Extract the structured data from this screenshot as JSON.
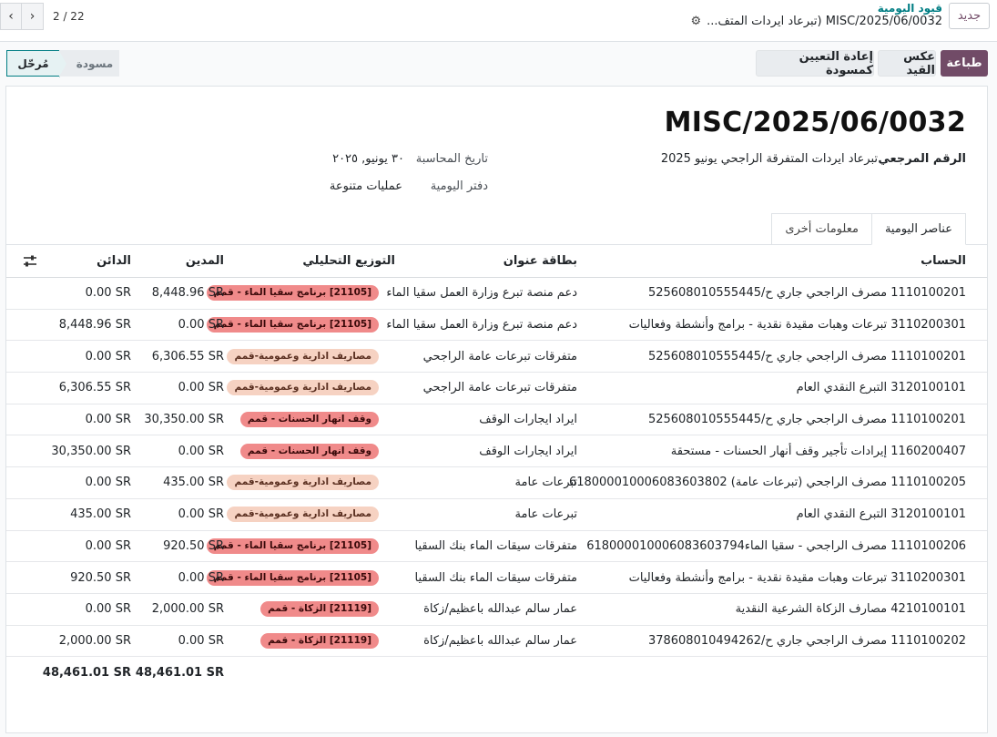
{
  "topbar": {
    "new_label": "جديد",
    "breadcrumb_parent": "قيود اليومية",
    "breadcrumb_current": "MISC/2025/06/0032 (تبرعاد ايردات المتف...",
    "pager_value": "2 / 22"
  },
  "actions": {
    "print": "طباعة",
    "reverse": "عكس القيد",
    "reset": "إعادة التعيين كمسودة"
  },
  "status": {
    "posted": "مُرحّل",
    "draft": "مسودة"
  },
  "form": {
    "title": "MISC/2025/06/0032",
    "ref_label": "الرقم المرجعي",
    "ref_value": "تبرعاد ايردات المتفرقة الراجحي يونيو 2025",
    "date_label": "تاريخ المحاسبة",
    "date_value": "٣٠ يونيو, ٢٠٢٥",
    "journal_label": "دفتر اليومية",
    "journal_value": "عمليات متنوعة"
  },
  "tabs": {
    "items": "عناصر اليومية",
    "other": "معلومات أخرى"
  },
  "table": {
    "headers": {
      "account": "الحساب",
      "label": "بطاقة عنوان",
      "analytic": "التوزيع التحليلي",
      "debit": "المدين",
      "credit": "الدائن"
    },
    "rows": [
      {
        "account": "1110100201 مصرف الراجحي جاري ح/525608010555445",
        "label": "دعم منصة تبرع وزارة العمل سقيا الماء",
        "tag": "[21105] برنامج سقيا الماء - قمم",
        "debit": "8,448.96 SR",
        "credit": "0.00 SR"
      },
      {
        "account": "3110200301 تبرعات وهبات مقيدة نقدية - برامج وأنشطة وفعاليات",
        "label": "دعم منصة تبرع وزارة العمل سقيا الماء",
        "tag": "[21105] برنامج سقيا الماء - قمم",
        "debit": "0.00 SR",
        "credit": "8,448.96 SR"
      },
      {
        "account": "1110100201 مصرف الراجحي جاري ح/525608010555445",
        "label": "متفرقات تبرعات عامة الراجحي",
        "tag": "مصاريف ادارية وعمومية-قمم",
        "debit": "6,306.55 SR",
        "credit": "0.00 SR"
      },
      {
        "account": "3120100101 التبرع النقدي العام",
        "label": "متفرقات تبرعات عامة الراجحي",
        "tag": "مصاريف ادارية وعمومية-قمم",
        "debit": "0.00 SR",
        "credit": "6,306.55 SR"
      },
      {
        "account": "1110100201 مصرف الراجحي جاري ح/525608010555445",
        "label": "ايراد ايجارات الوقف",
        "tag": "وقف انهار الحسنات - قمم",
        "debit": "30,350.00 SR",
        "credit": "0.00 SR"
      },
      {
        "account": "1160200407 إيرادات تأجير وقف أنهار الحسنات - مستحقة",
        "label": "ايراد ايجارات الوقف",
        "tag": "وقف انهار الحسنات - قمم",
        "debit": "0.00 SR",
        "credit": "30,350.00 SR"
      },
      {
        "account": "1110100205 مصرف الراجحي (تبرعات عامة) 618000010006083603802",
        "label": "تبرعات عامة",
        "tag": "مصاريف ادارية وعمومية-قمم",
        "debit": "435.00 SR",
        "credit": "0.00 SR"
      },
      {
        "account": "3120100101 التبرع النقدي العام",
        "label": "تبرعات عامة",
        "tag": "مصاريف ادارية وعمومية-قمم",
        "debit": "0.00 SR",
        "credit": "435.00 SR"
      },
      {
        "account": "1110100206 مصرف الراجحي - سقيا الماء618000010006083603794",
        "label": "متفرقات سيقات الماء بنك السقيا",
        "tag": "[21105] برنامج سقيا الماء - قمم",
        "debit": "920.50 SR",
        "credit": "0.00 SR"
      },
      {
        "account": "3110200301 تبرعات وهبات مقيدة نقدية - برامج وأنشطة وفعاليات",
        "label": "متفرقات سيقات الماء بنك السقيا",
        "tag": "[21105] برنامج سقيا الماء - قمم",
        "debit": "0.00 SR",
        "credit": "920.50 SR"
      },
      {
        "account": "4210100101 مصارف الزكاة الشرعية النقدية",
        "label": "عمار سالم عبدالله باعظيم/زكاة",
        "tag": "[21119] الزكاة - قمم",
        "debit": "2,000.00 SR",
        "credit": "0.00 SR"
      },
      {
        "account": "1110100202 مصرف الراجحي جاري ح/378608010494262",
        "label": "عمار سالم عبدالله باعظيم/زكاة",
        "tag": "[21119] الزكاة - قمم",
        "debit": "0.00 SR",
        "credit": "2,000.00 SR"
      }
    ],
    "tag_styles": [
      "red",
      "red",
      "peach",
      "peach",
      "red",
      "red",
      "peach",
      "peach",
      "red",
      "red",
      "red",
      "red"
    ],
    "total_debit": "48,461.01 SR",
    "total_credit": "48,461.01 SR"
  },
  "colors": {
    "brand": "#714b67",
    "accent": "#017e84",
    "tag_red": "#f08a8a",
    "tag_peach": "#f6d2c2"
  },
  "icons": {
    "gear": "gear-icon",
    "prev": "chevron-left-icon",
    "next": "chevron-right-icon",
    "settings": "sliders-icon"
  }
}
